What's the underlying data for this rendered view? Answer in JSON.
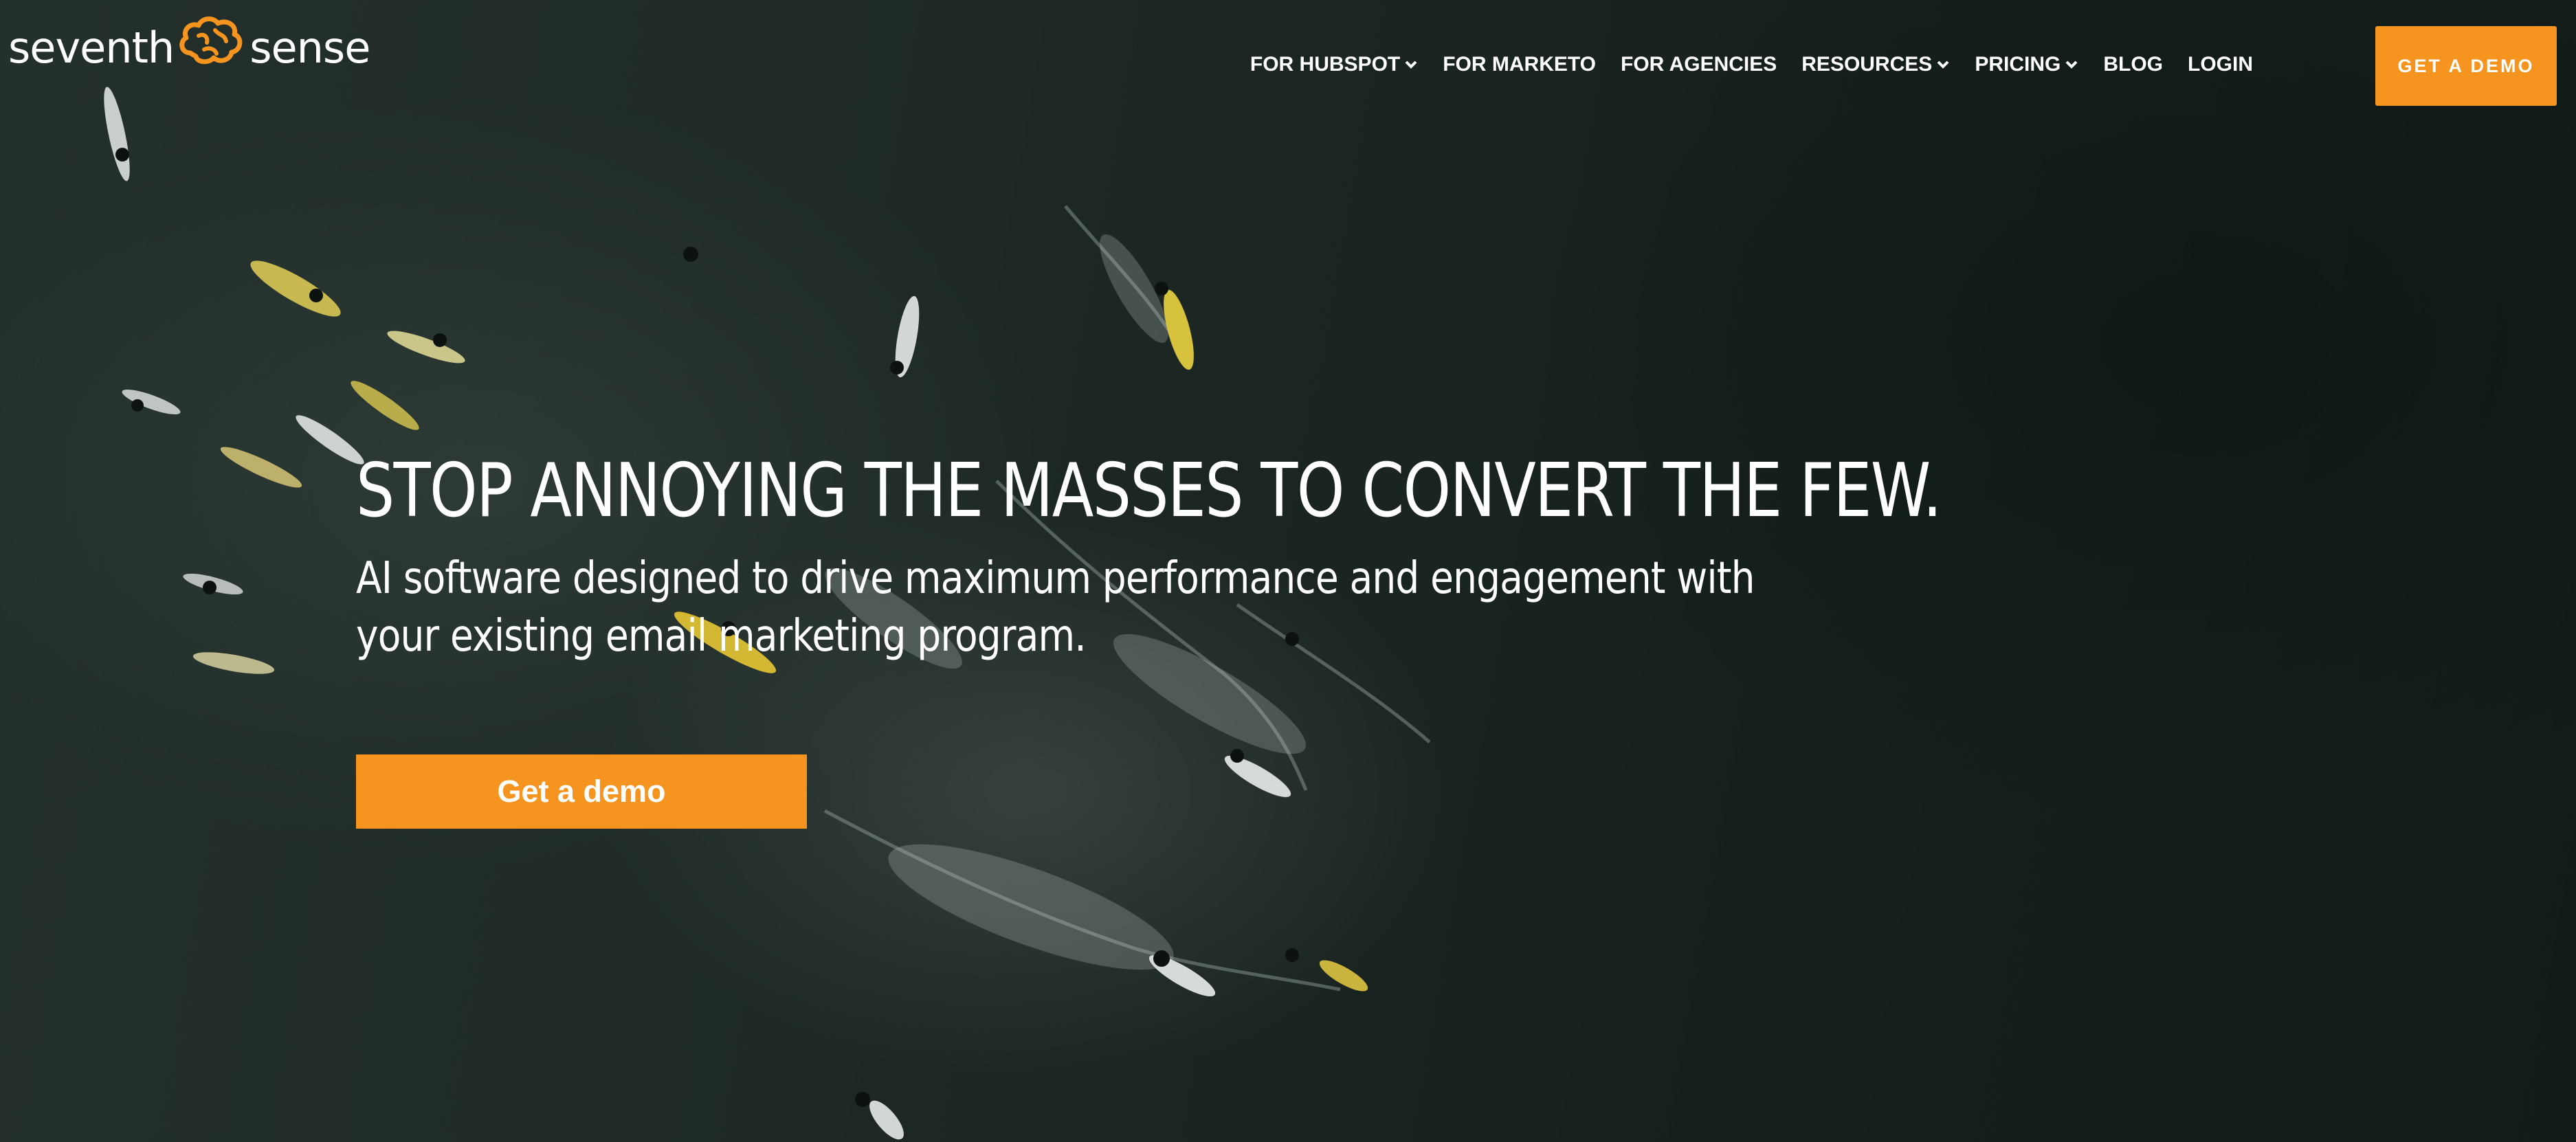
{
  "header": {
    "logo": {
      "word_left": "seventh",
      "word_right": "sense",
      "icon": "brain-icon",
      "icon_color": "#f5941e"
    },
    "nav": [
      {
        "label": "FOR HUBSPOT",
        "dropdown": true
      },
      {
        "label": "FOR MARKETO",
        "dropdown": false
      },
      {
        "label": "FOR AGENCIES",
        "dropdown": false
      },
      {
        "label": "RESOURCES",
        "dropdown": true
      },
      {
        "label": "PRICING",
        "dropdown": true
      },
      {
        "label": "BLOG",
        "dropdown": false
      },
      {
        "label": "LOGIN",
        "dropdown": false
      }
    ],
    "demo_button": "GET A DEMO"
  },
  "hero": {
    "headline": "STOP ANNOYING THE MASSES TO CONVERT THE FEW.",
    "subheadline": "AI software designed to drive maximum performance and engagement with your existing email marketing program.",
    "cta": "Get a demo"
  },
  "colors": {
    "accent": "#f5941e",
    "background": "#1b2621",
    "text": "#ffffff"
  }
}
